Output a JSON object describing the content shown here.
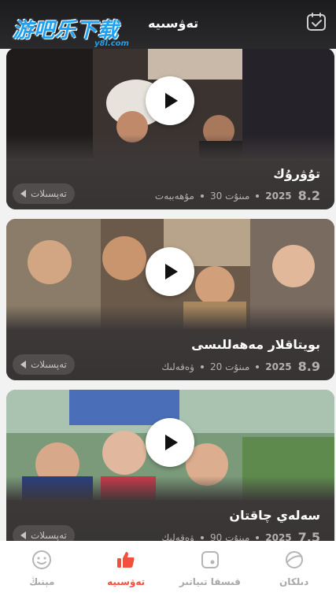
{
  "watermark": {
    "logo_text": "游吧乐下载",
    "logo_sub": "y8l.com"
  },
  "header": {
    "title": "تەۋسىيە",
    "calendar_icon": "calendar-check-icon"
  },
  "cards": [
    {
      "title": "تۇۋرۇك",
      "rating": "8.2",
      "year": "2025",
      "duration": "30 مىنۇت",
      "genre": "مۇھەببەت",
      "details_label": "تەپسىلات"
    },
    {
      "title": "بويتاقلار مەھەللىسى",
      "rating": "8.9",
      "year": "2025",
      "duration": "20 مىنۇت",
      "genre": "ۋەقەلىك",
      "details_label": "تەپسىلات"
    },
    {
      "title": "سەلەي چاقتان",
      "rating": "7.5",
      "year": "2025",
      "duration": "90 مىنۇت",
      "genre": "ۋەقەلىك",
      "details_label": "تەپسىلات"
    }
  ],
  "tabs": [
    {
      "label": "مېنىڭ",
      "icon": "smile-face-icon",
      "active": false
    },
    {
      "label": "تەۋسىيە",
      "icon": "thumbs-up-icon",
      "active": true
    },
    {
      "label": "قىسقا تىياتىر",
      "icon": "play-square-icon",
      "active": false
    },
    {
      "label": "دىلكان",
      "icon": "planet-icon",
      "active": false
    }
  ],
  "colors": {
    "accent": "#f0503c",
    "header_bg": "#1c1c1e",
    "tab_inactive": "#a8a8a8"
  }
}
